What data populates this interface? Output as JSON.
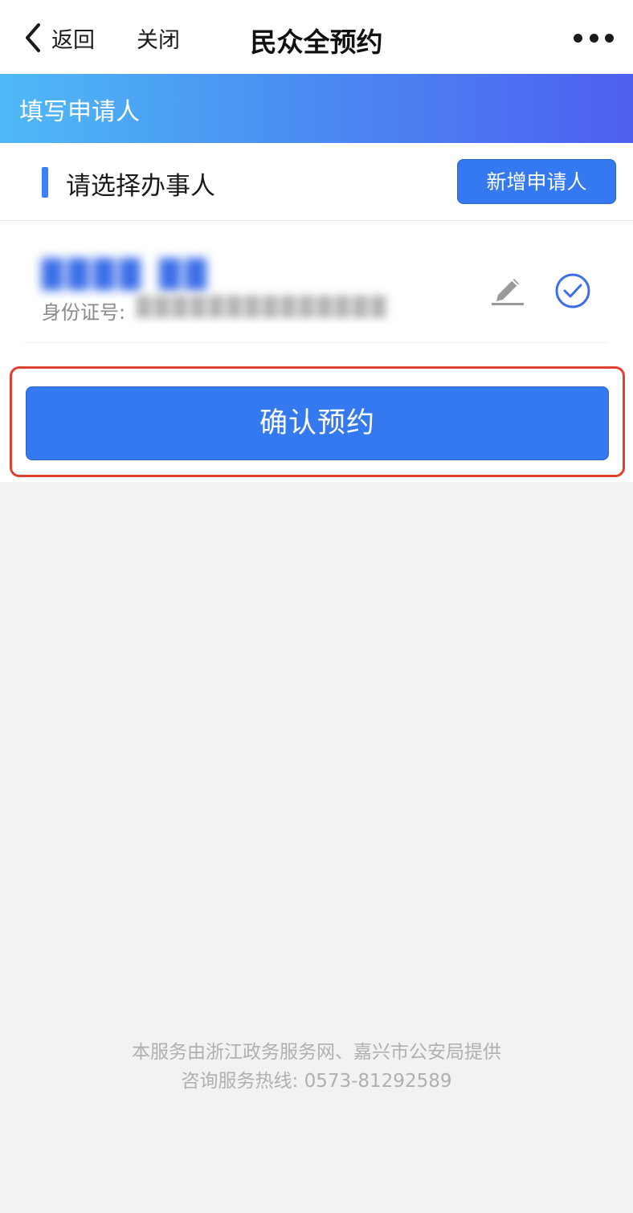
{
  "nav": {
    "back_label": "返回",
    "close_label": "关闭",
    "title": "民众全预约"
  },
  "banner": {
    "title": "填写申请人"
  },
  "section": {
    "title": "请选择办事人",
    "add_button": "新增申请人"
  },
  "applicant": {
    "name": "████ ██",
    "id_label": "身份证号:",
    "id_value": "██████████████"
  },
  "confirm": {
    "label": "确认预约"
  },
  "footer": {
    "provider": "本服务由浙江政务服务网、嘉兴市公安局提供",
    "hotline": "咨询服务热线: 0573-81292589"
  },
  "colors": {
    "accent": "#3479f0",
    "highlight_border": "#e04030",
    "banner_gradient_start": "#4fb9f6",
    "banner_gradient_end": "#4e5ff0"
  }
}
